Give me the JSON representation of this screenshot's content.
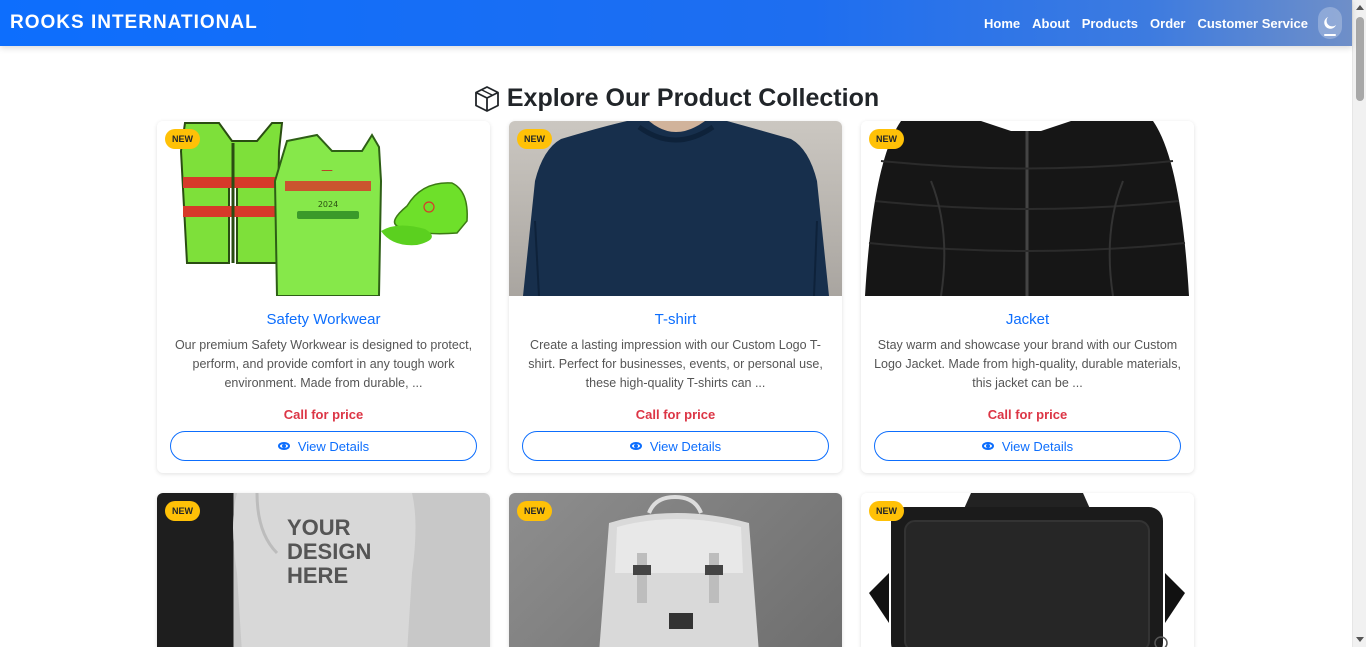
{
  "navbar": {
    "brand": "ROOKS INTERNATIONAL",
    "links": [
      "Home",
      "About",
      "Products",
      "Order",
      "Customer Service"
    ],
    "theme_toggle_icon": "moon-icon"
  },
  "section": {
    "title": "Explore Our Product Collection",
    "icon": "box-icon"
  },
  "products": [
    {
      "badge": "NEW",
      "name": "Safety Workwear",
      "description": "Our premium Safety Workwear is designed to protect, perform, and provide comfort in any tough work environment. Made from durable, ...",
      "price": "Call for price",
      "button": "View Details",
      "image_text": [
        "2024"
      ]
    },
    {
      "badge": "NEW",
      "name": "T-shirt",
      "description": "Create a lasting impression with our Custom Logo T-shirt. Perfect for businesses, events, or personal use, these high-quality T-shirts can ...",
      "price": "Call for price",
      "button": "View Details"
    },
    {
      "badge": "NEW",
      "name": "Jacket",
      "description": "Stay warm and showcase your brand with our Custom Logo Jacket. Made from high-quality, durable materials, this jacket can be ...",
      "price": "Call for price",
      "button": "View Details"
    },
    {
      "badge": "NEW",
      "image_text": [
        "YOUR",
        "DESIGN",
        "HERE"
      ]
    },
    {
      "badge": "NEW"
    },
    {
      "badge": "NEW"
    }
  ],
  "colors": {
    "primary": "#0d6efd",
    "badge": "#ffc107",
    "price": "#dc3545"
  }
}
